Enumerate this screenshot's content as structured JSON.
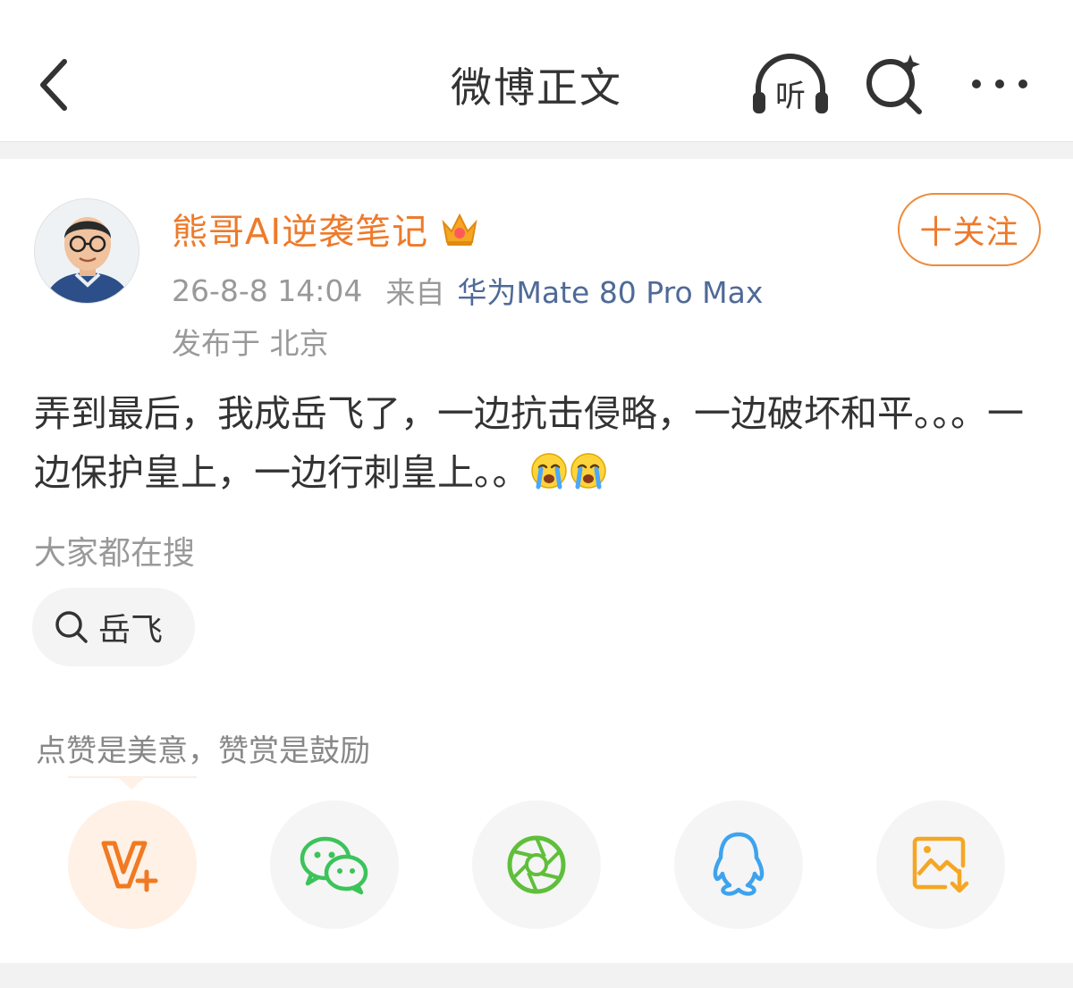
{
  "header": {
    "title": "微博正文",
    "listen_label": "听"
  },
  "post": {
    "username": "熊哥AI逆袭笔记",
    "follow_label": "十关注",
    "timestamp": "26-8-8 14:04",
    "from_label": "来自",
    "device": "华为Mate 80 Pro Max",
    "location": "发布于 北京",
    "text_part1": "弄到最后，我成岳飞了，一边抗击侵略，一边破坏和平。。。一边保护皇上，一边行刺皇上。。",
    "emoji": [
      "crying-emoji",
      "crying-emoji"
    ]
  },
  "search": {
    "hint": "大家都在搜",
    "chip_label": "岳飞"
  },
  "reward": {
    "hint": "点赞是美意，赞赏是鼓励"
  },
  "share": {
    "items": [
      "vplus-reward",
      "wechat",
      "moments",
      "qq",
      "save-image"
    ]
  },
  "colors": {
    "accent": "#ee7a2a",
    "device_link": "#4f6a98",
    "wechat_green": "#3cc35a",
    "qq_blue": "#3ea3ee",
    "save_orange": "#f5a623"
  }
}
